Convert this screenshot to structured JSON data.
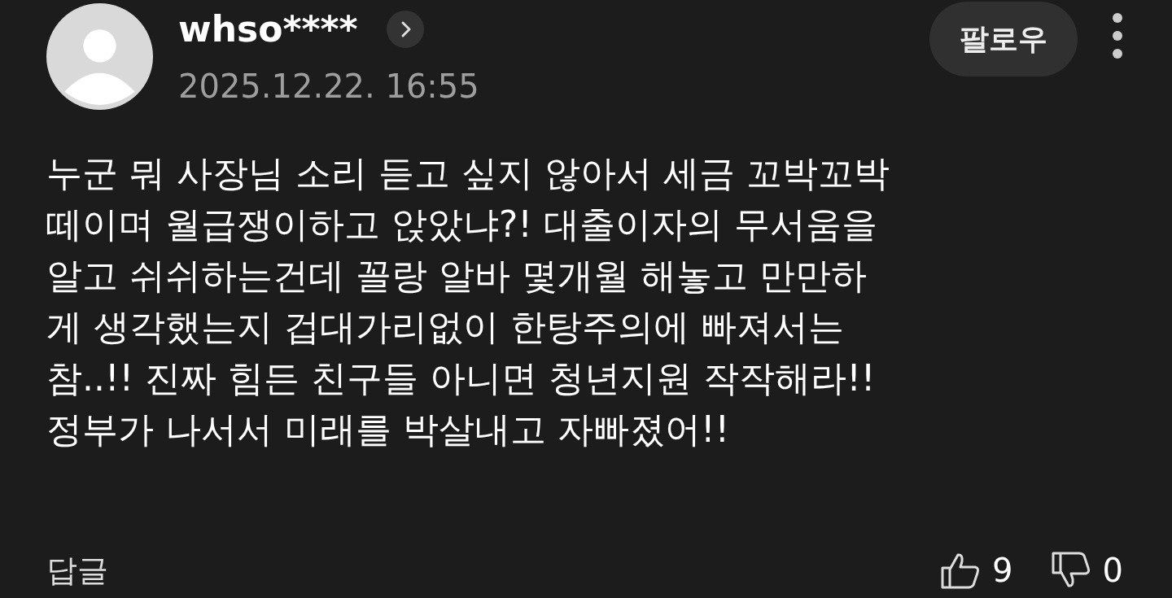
{
  "comment": {
    "author": "whso****",
    "timestamp": "2025.12.22. 16:55",
    "follow_button": "팔로우",
    "body": "누군 뭐 사장님 소리 듣고 싶지 않아서 세금 꼬박꼬박\n떼이며 월급쟁이하고 앉았냐?! 대출이자의 무서움을\n알고 쉬쉬하는건데 꼴랑 알바 몇개월 해놓고 만만하\n게 생각했는지 겁대가리없이 한탕주의에 빠져서는\n참..!! 진짜 힘든 친구들 아니면 청년지원 작작해라!!\n정부가 나서서 미래를 박살내고 자빠졌어!!",
    "reply_link": "답글",
    "likes": "9",
    "dislikes": "0"
  }
}
